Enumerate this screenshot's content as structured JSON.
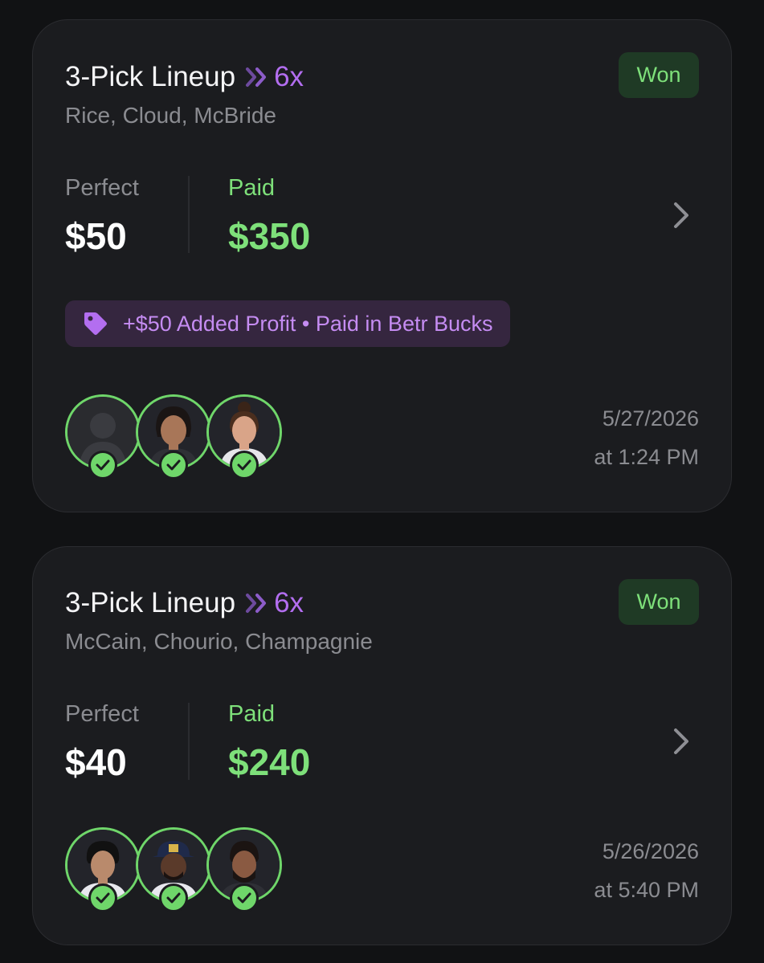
{
  "lineups": [
    {
      "title": "3-Pick Lineup",
      "multiplier": "6x",
      "players": "Rice, Cloud, McBride",
      "status": "Won",
      "perfect_label": "Perfect",
      "perfect_value": "$50",
      "paid_label": "Paid",
      "paid_value": "$350",
      "promo": "+$50 Added Profit • Paid in Betr Bucks",
      "date": "5/27/2026",
      "time": "at 1:24 PM"
    },
    {
      "title": "3-Pick Lineup",
      "multiplier": "6x",
      "players": "McCain, Chourio, Champagnie",
      "status": "Won",
      "perfect_label": "Perfect",
      "perfect_value": "$40",
      "paid_label": "Paid",
      "paid_value": "$240",
      "date": "5/26/2026",
      "time": "at 5:40 PM"
    }
  ],
  "colors": {
    "background": "#111214",
    "card": "#1b1c1f",
    "accent_purple": "#b36ef0",
    "win_green": "#7ee07a",
    "badge_bg": "#1f3a25",
    "promo_bg": "#35263f"
  },
  "icons": [
    "double-chevron-icon",
    "chevron-right-icon",
    "tag-icon",
    "checkmark-icon"
  ]
}
